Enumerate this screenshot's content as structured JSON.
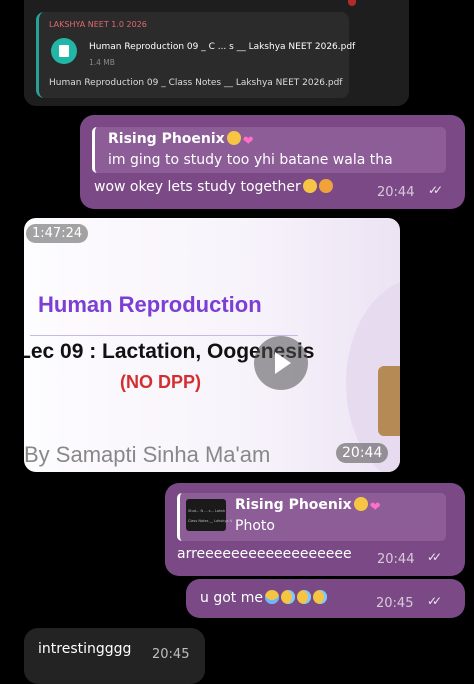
{
  "file_message": {
    "channel": "LAKSHYA NEET 1.0 2026",
    "file_name": "Human Reproduction 09 _ C ... s __ Lakshya NEET 2026.pdf",
    "file_size": "1.4 MB",
    "caption": "Human Reproduction 09 _ Class Notes __ Lakshya NEET 2026.pdf"
  },
  "message_1": {
    "reply_name": "Rising Phoenix",
    "reply_text": "im ging to study too yhi batane wala tha",
    "text": "wow okey lets study together",
    "time": "20:44",
    "status_icon": "double-check-icon"
  },
  "video_message": {
    "duration": "1:47:24",
    "title": "Human Reproduction",
    "lecture": "Lec 09 : Lactation, Oogenesis",
    "note": "(NO DPP)",
    "teacher": "By Samapti Sinha Ma'am",
    "time": "20:44"
  },
  "message_2": {
    "reply_name": "Rising Phoenix",
    "reply_text": "Photo",
    "thumb_text_1": "Stud...  N ... s... Laksh",
    "thumb_text_2": "Class Notes __ Lakshya N",
    "text": "arreeeeeeeeeeeeeeeeee",
    "time": "20:44"
  },
  "message_3": {
    "text": "u got me",
    "time": "20:45"
  },
  "message_4": {
    "text": "intrestingggg",
    "time": "20:45"
  },
  "colors": {
    "outgoing_bubble": "#7b4a86",
    "incoming_bubble": "#232323",
    "accent_teal": "#22b6a6",
    "video_title": "#7b3fd4",
    "no_dpp": "#d23030"
  }
}
